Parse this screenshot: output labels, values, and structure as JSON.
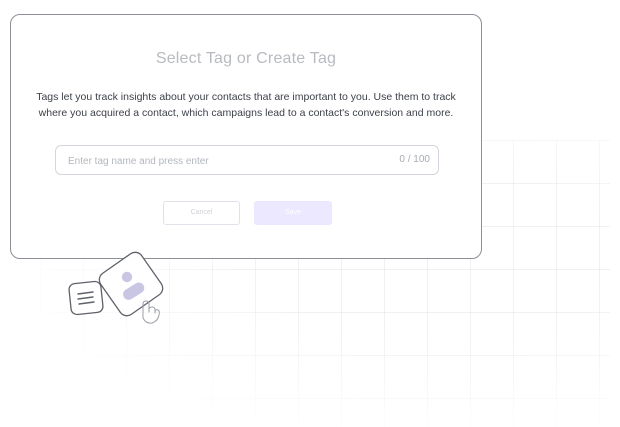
{
  "modal": {
    "title": "Select Tag or Create Tag",
    "description": "Tags let you track insights about your contacts that are important to you. Use them to track where you acquired a contact, which campaigns lead to a contact's conversion and more.",
    "input": {
      "placeholder": "Enter tag name and press enter",
      "value": ""
    },
    "char_counter": "0 / 100",
    "cancel_label": "Cancel",
    "save_label": "Save"
  },
  "colors": {
    "modal_border": "#8c8f96",
    "title_text": "#b7bac0",
    "save_bg": "#ece8ff",
    "illustration_accent": "#c9c6e4"
  },
  "illustration": {
    "icons": [
      "contact-card-icon",
      "list-note-icon",
      "hand-cursor-icon"
    ]
  }
}
